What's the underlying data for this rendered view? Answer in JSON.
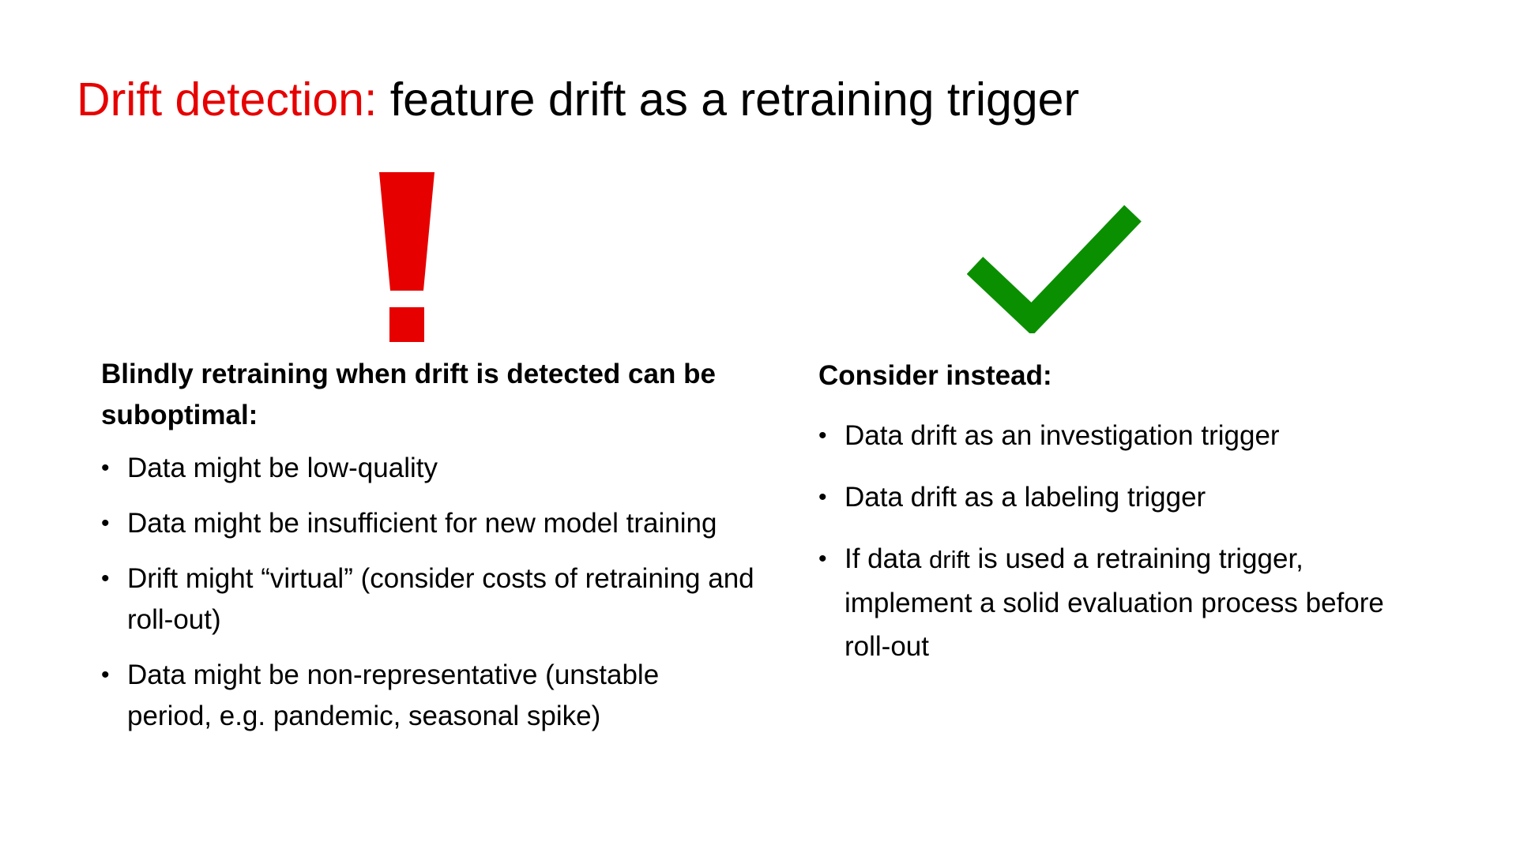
{
  "slide": {
    "title_accent": "Drift detection:",
    "title_rest": " feature drift as a retraining trigger",
    "colors": {
      "accent": "#e60000",
      "check": "#0a8f00",
      "text": "#000000",
      "background": "#ffffff"
    },
    "left": {
      "icon": "exclamation-icon",
      "heading": "Blindly retraining when drift is detected can be suboptimal:",
      "items": [
        "Data might be low-quality",
        "Data might be insufficient for new model training",
        "Drift might “virtual” (consider costs of retraining and roll-out)",
        "Data might be non-representative (unstable period, e.g. pandemic, seasonal spike)"
      ]
    },
    "right": {
      "icon": "checkmark-icon",
      "heading": "Consider instead:",
      "items": [
        "Data drift as an investigation trigger",
        "Data drift as a labeling trigger",
        {
          "before": "If data ",
          "small": "drift",
          "after": " is used a retraining trigger, implement a solid evaluation process before roll-out"
        }
      ]
    },
    "bullet_glyph": "•"
  }
}
